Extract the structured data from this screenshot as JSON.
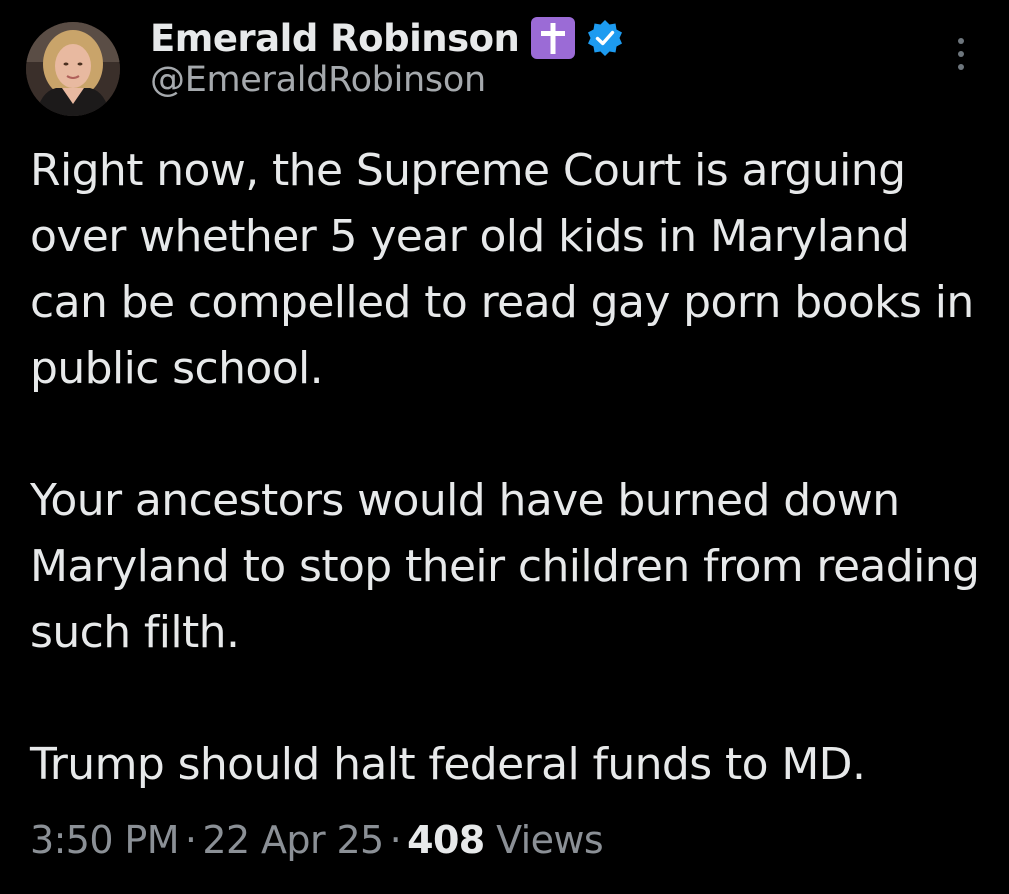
{
  "author": {
    "display_name": "Emerald Robinson",
    "handle": "@EmeraldRobinson",
    "emoji": "cross-emoji",
    "verified": true,
    "verified_color": "#1d9bf0"
  },
  "tweet": {
    "paragraphs": [
      "Right now, the Supreme Court is arguing over whether 5 year old kids in Maryland can be compelled to read gay porn books in public school.",
      "Your ancestors would have burned down Maryland to stop their children from reading such filth.",
      "Trump should halt federal funds to MD."
    ],
    "time": "3:50 PM",
    "separator": "·",
    "date": "22 Apr 25",
    "view_count": "408",
    "views_label": "Views"
  },
  "colors": {
    "background": "#000000",
    "text": "#e7e9ea",
    "secondary": "#8b9096",
    "emoji_purple": "#9b6bd6"
  },
  "icons": {
    "more": "more-vertical-icon",
    "verified": "verified-badge-icon"
  }
}
